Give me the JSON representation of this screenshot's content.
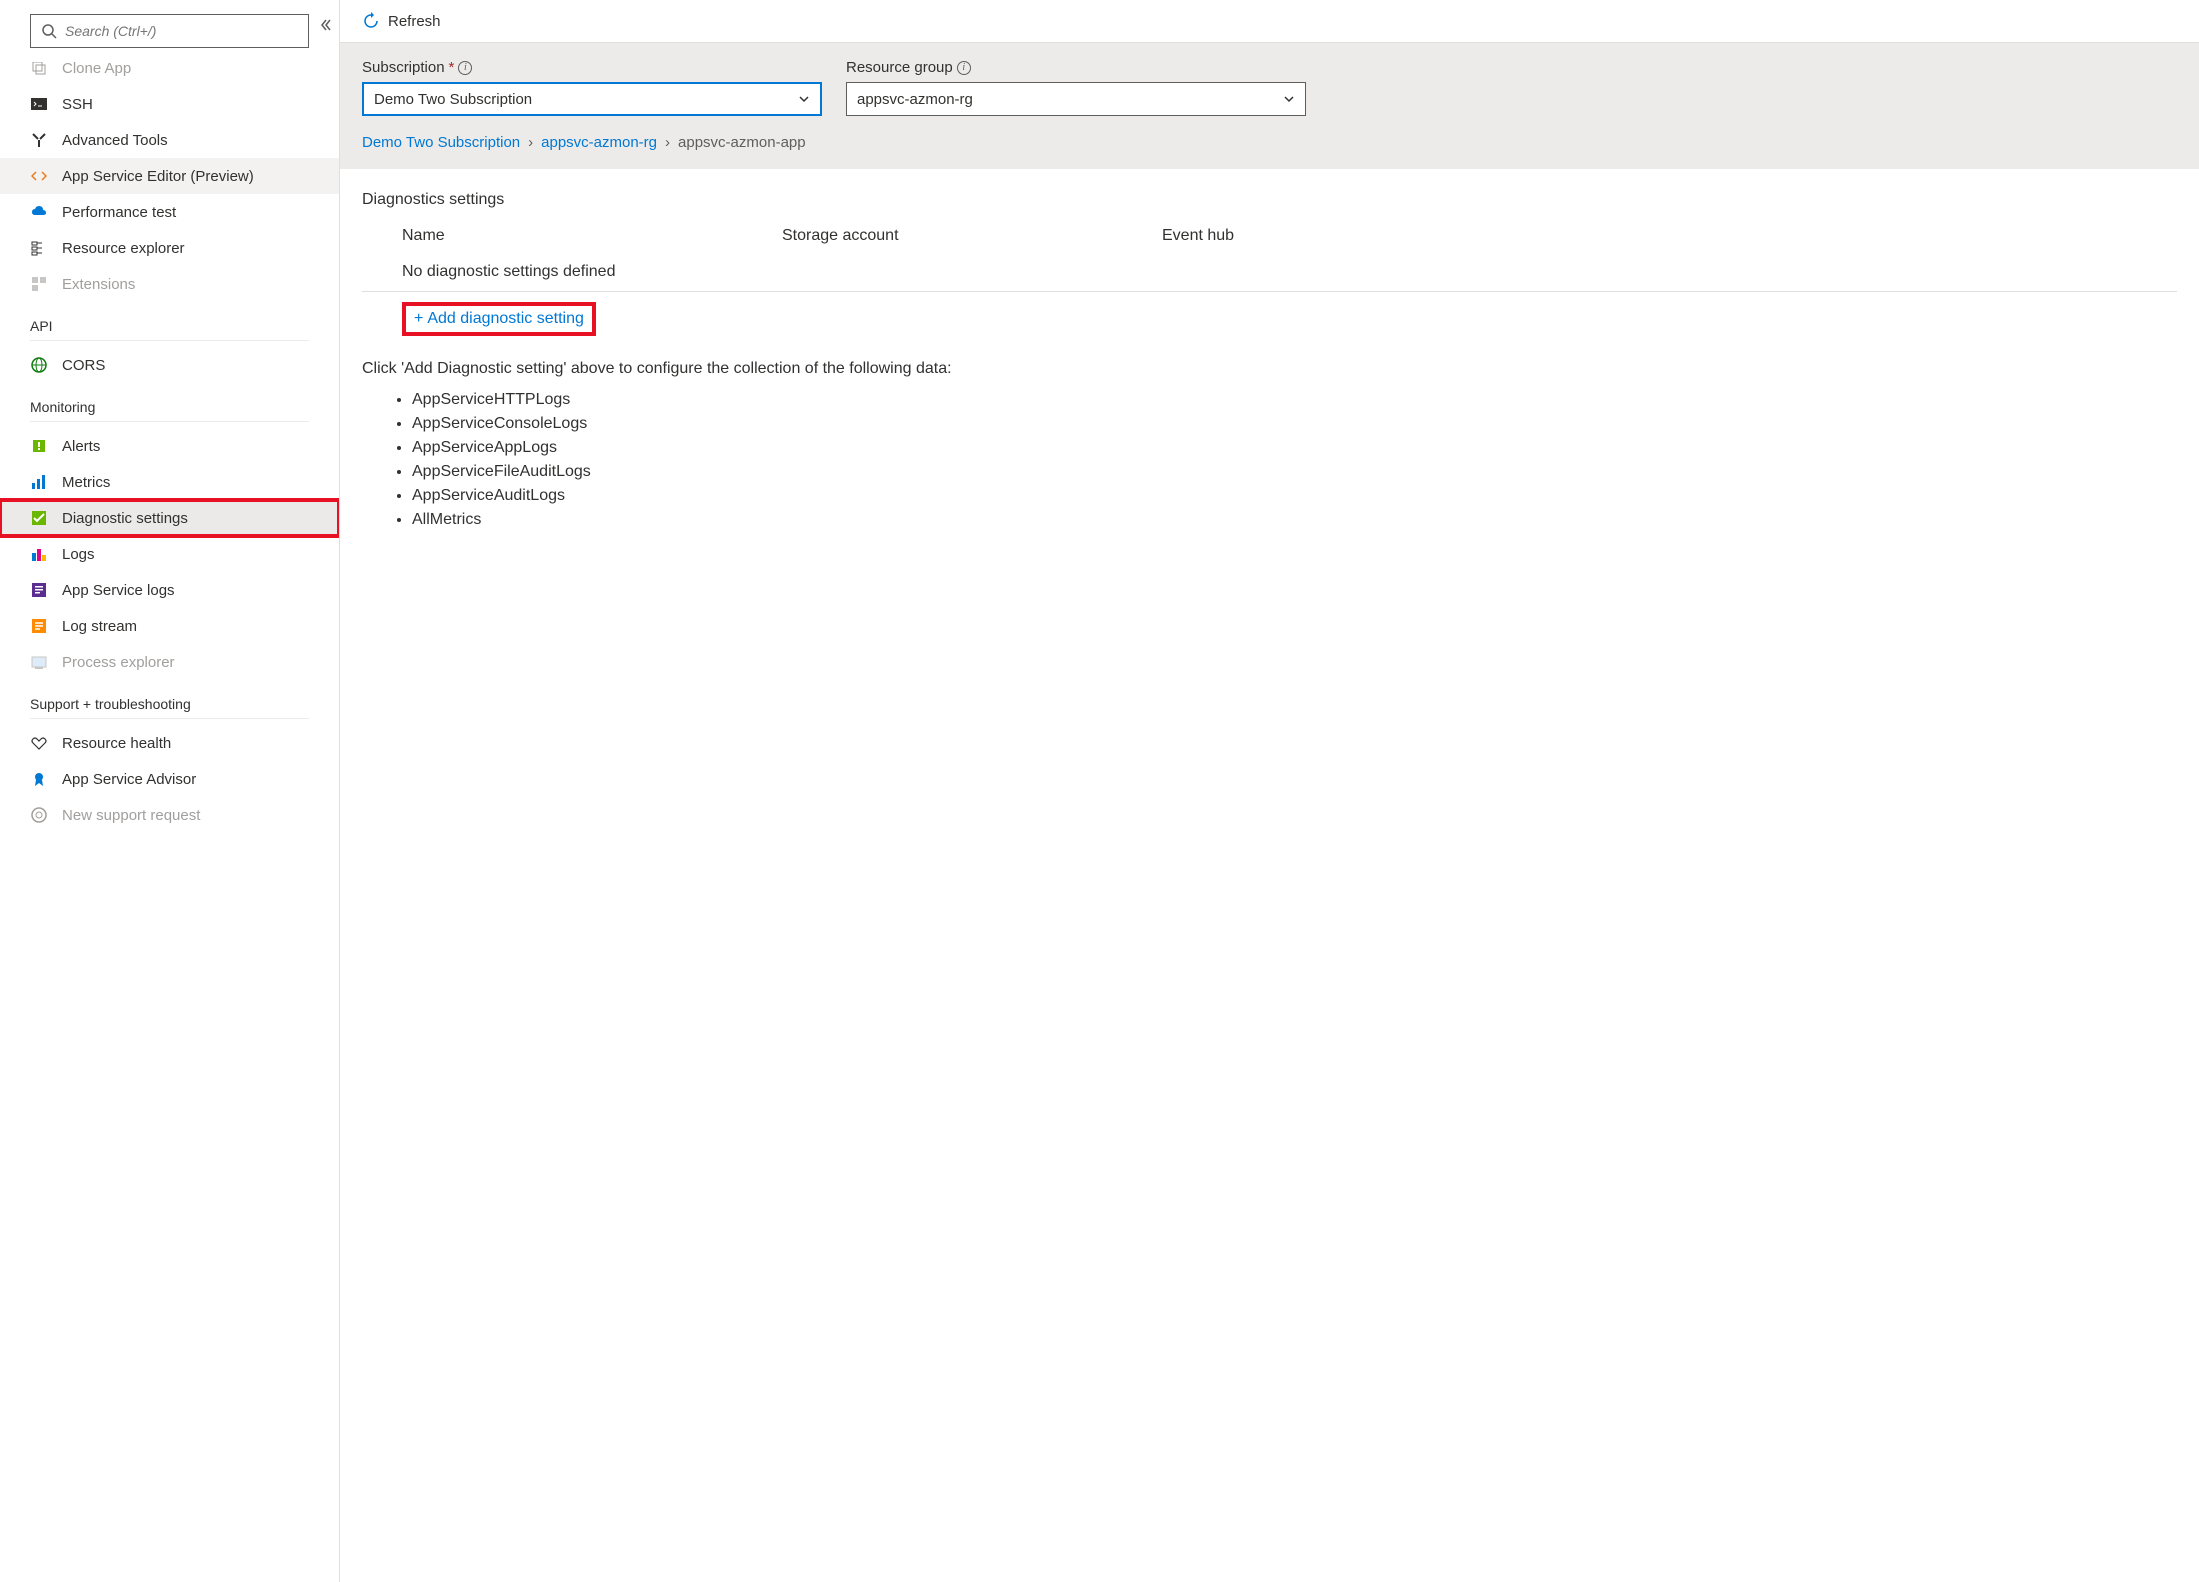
{
  "sidebar": {
    "search_placeholder": "Search (Ctrl+/)",
    "items_ungrouped": [
      {
        "label": "Clone App"
      },
      {
        "label": "SSH"
      },
      {
        "label": "Advanced Tools"
      },
      {
        "label": "App Service Editor (Preview)"
      },
      {
        "label": "Performance test"
      },
      {
        "label": "Resource explorer"
      },
      {
        "label": "Extensions"
      }
    ],
    "group_api": {
      "title": "API",
      "items": [
        {
          "label": "CORS"
        }
      ]
    },
    "group_monitoring": {
      "title": "Monitoring",
      "items": [
        {
          "label": "Alerts"
        },
        {
          "label": "Metrics"
        },
        {
          "label": "Diagnostic settings"
        },
        {
          "label": "Logs"
        },
        {
          "label": "App Service logs"
        },
        {
          "label": "Log stream"
        },
        {
          "label": "Process explorer"
        }
      ]
    },
    "group_support": {
      "title": "Support + troubleshooting",
      "items": [
        {
          "label": "Resource health"
        },
        {
          "label": "App Service Advisor"
        },
        {
          "label": "New support request"
        }
      ]
    }
  },
  "toolbar": {
    "refresh_label": "Refresh"
  },
  "filters": {
    "subscription_label": "Subscription",
    "subscription_value": "Demo Two Subscription",
    "resource_group_label": "Resource group",
    "resource_group_value": "appsvc-azmon-rg"
  },
  "breadcrumb": {
    "sub": "Demo Two Subscription",
    "rg": "appsvc-azmon-rg",
    "app": "appsvc-azmon-app"
  },
  "diagnostics": {
    "title": "Diagnostics settings",
    "col_name": "Name",
    "col_storage": "Storage account",
    "col_event": "Event hub",
    "empty_text": "No diagnostic settings defined",
    "add_label": "Add diagnostic setting",
    "help_text": "Click 'Add Diagnostic setting' above to configure the collection of the following data:",
    "data_types": [
      "AppServiceHTTPLogs",
      "AppServiceConsoleLogs",
      "AppServiceAppLogs",
      "AppServiceFileAuditLogs",
      "AppServiceAuditLogs",
      "AllMetrics"
    ]
  }
}
